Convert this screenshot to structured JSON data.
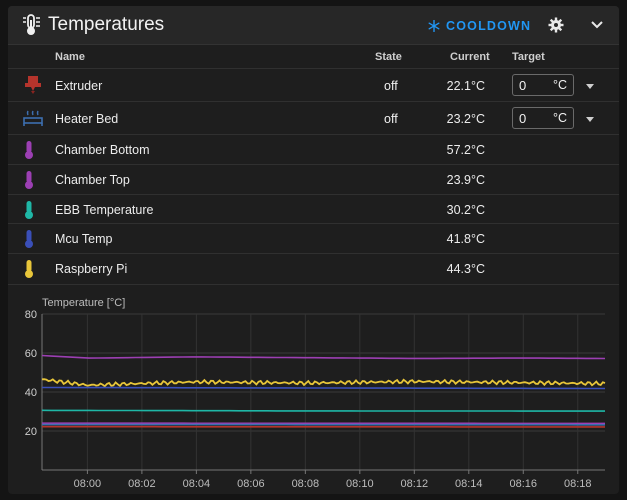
{
  "header": {
    "title": "Temperatures",
    "cooldown_label": "COOLDOWN"
  },
  "table": {
    "columns": {
      "name": "Name",
      "state": "State",
      "current": "Current",
      "target": "Target"
    },
    "rows": [
      {
        "name": "Extruder",
        "state": "off",
        "current": "22.1°C",
        "target": "0",
        "target_unit": "°C",
        "icon": "extruder-icon",
        "color": "#b5342c"
      },
      {
        "name": "Heater Bed",
        "state": "off",
        "current": "23.2°C",
        "target": "0",
        "target_unit": "°C",
        "icon": "heater-bed-icon",
        "color": "#3d6fb0"
      },
      {
        "name": "Chamber Bottom",
        "state": "",
        "current": "57.2°C",
        "icon": "thermometer-icon",
        "color": "#9c3fb3"
      },
      {
        "name": "Chamber Top",
        "state": "",
        "current": "23.9°C",
        "icon": "thermometer-icon",
        "color": "#9c3fb3"
      },
      {
        "name": "EBB Temperature",
        "state": "",
        "current": "30.2°C",
        "icon": "thermometer-icon",
        "color": "#1fb7a6"
      },
      {
        "name": "Mcu Temp",
        "state": "",
        "current": "41.8°C",
        "icon": "thermometer-icon",
        "color": "#3a4fb8"
      },
      {
        "name": "Raspberry Pi",
        "state": "",
        "current": "44.3°C",
        "icon": "thermometer-icon",
        "color": "#e8c63a"
      }
    ]
  },
  "chart_data": {
    "type": "line",
    "ylabel": "Temperature [°C]",
    "ylim": [
      0,
      80
    ],
    "yticks": [
      20,
      40,
      60,
      80
    ],
    "xlim": [
      "07:58:20",
      "08:19:00"
    ],
    "xticks": [
      "08:00",
      "08:02",
      "08:04",
      "08:06",
      "08:08",
      "08:10",
      "08:12",
      "08:14",
      "08:16",
      "08:18"
    ],
    "grid": true,
    "series": [
      {
        "color": "#9c3fb3",
        "x": [
          "07:58:20",
          "08:00",
          "08:04",
          "08:08",
          "08:12",
          "08:16",
          "08:19"
        ],
        "values": [
          58.7,
          57.4,
          58.0,
          57.6,
          57.2,
          57.4,
          57.2
        ]
      },
      {
        "color": "#e8c63a",
        "x": [
          "07:58:20",
          "08:00",
          "08:04",
          "08:08",
          "08:12",
          "08:16",
          "08:19"
        ],
        "values": [
          46.5,
          43.5,
          45.2,
          44.6,
          45.4,
          44.8,
          44.3
        ]
      },
      {
        "color": "#3a4fb8",
        "x": [
          "07:58:20",
          "08:19"
        ],
        "values": [
          42.3,
          41.8
        ]
      },
      {
        "color": "#1fb7a6",
        "x": [
          "07:58:20",
          "08:08",
          "08:19"
        ],
        "values": [
          30.6,
          30.3,
          30.2
        ]
      },
      {
        "color": "#9c3fb3",
        "x": [
          "07:58:20",
          "08:19"
        ],
        "values": [
          24.0,
          23.9
        ]
      },
      {
        "color": "#3d6fb0",
        "x": [
          "07:58:20",
          "08:19"
        ],
        "values": [
          23.3,
          23.2
        ]
      },
      {
        "color": "#b5342c",
        "x": [
          "07:58:20",
          "08:19"
        ],
        "values": [
          22.2,
          22.1
        ]
      }
    ]
  }
}
